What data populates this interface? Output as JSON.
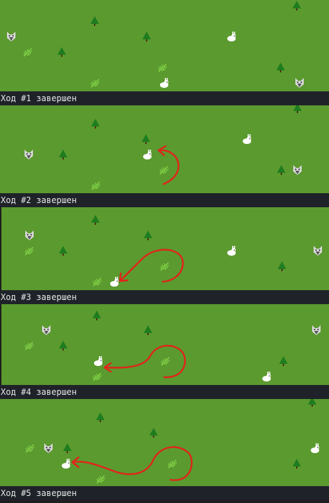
{
  "colors": {
    "grass": "#5b9a2f",
    "caption_bg": "#1f2329",
    "caption_text": "#e6e6e6",
    "path_arrow": "#e0241b",
    "tree": "#1e7d1e",
    "herb": "#7fd046",
    "rabbit": "#ffffff",
    "wolf": "#d9d9d9"
  },
  "legend": {
    "tree": "tree-icon",
    "herb": "herb-icon",
    "rabbit": "rabbit-icon",
    "wolf": "wolf-icon"
  },
  "turns": [
    {
      "caption": "Ход #1 завершен"
    },
    {
      "caption": "Ход #2 завершен"
    },
    {
      "caption": "Ход #3 завершен"
    },
    {
      "caption": "Ход #4 завершен"
    },
    {
      "caption": "Ход #5 завершен"
    }
  ]
}
